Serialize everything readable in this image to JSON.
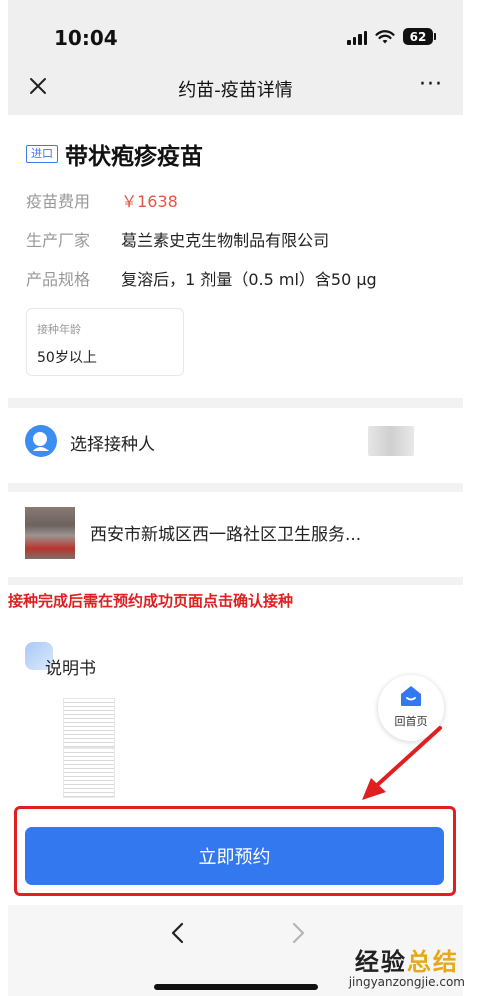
{
  "status_bar": {
    "time": "10:04",
    "battery": "62"
  },
  "nav": {
    "title": "约苗-疫苗详情",
    "close_icon": "close-icon",
    "more": "···"
  },
  "vaccine": {
    "tag": "进口",
    "name": "带状疱疹疫苗",
    "fee_label": "疫苗费用",
    "fee_value": "￥1638",
    "maker_label": "生产厂家",
    "maker_value": "葛兰素史克生物制品有限公司",
    "spec_label": "产品规格",
    "spec_value": "复溶后，1 剂量（0.5 ml）含50 μg",
    "age_label": "接种年龄",
    "age_value": "50岁以上"
  },
  "recipient": {
    "label": "选择接种人"
  },
  "clinic": {
    "name": "西安市新城区西一路社区卫生服务..."
  },
  "annotation": "接种完成后需在预约成功页面点击确认接种",
  "manual": {
    "title": "说明书"
  },
  "home_float": {
    "label": "回首页"
  },
  "book_button": {
    "label": "立即预约"
  },
  "watermark": {
    "main_left": "经验",
    "main_right": "总结",
    "sub": "jingyanzongjie.com"
  },
  "colors": {
    "primary": "#3478f0",
    "price": "#e25745",
    "annotation": "#e02020",
    "watermark_accent": "#e8a81c"
  }
}
